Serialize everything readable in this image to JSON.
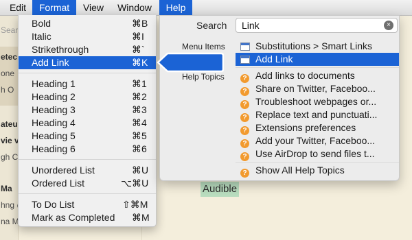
{
  "menubar": {
    "items": [
      {
        "label": "Edit",
        "active": false
      },
      {
        "label": "Format",
        "active": true
      },
      {
        "label": "View",
        "active": false
      },
      {
        "label": "Window",
        "active": false
      },
      {
        "label": "Help",
        "active": true
      }
    ]
  },
  "background": {
    "sidebar_fragments": [
      "Sear",
      "etec",
      "one",
      "h O",
      "ateu",
      "vie v",
      "gh C",
      "Ma",
      "hng @",
      "na M"
    ],
    "editor_text": "Audible"
  },
  "format_menu": {
    "groups": [
      [
        {
          "label": "Bold",
          "shortcut": "⌘B"
        },
        {
          "label": "Italic",
          "shortcut": "⌘I"
        },
        {
          "label": "Strikethrough",
          "shortcut": "⌘`"
        },
        {
          "label": "Add Link",
          "shortcut": "⌘K",
          "highlighted": true
        }
      ],
      [
        {
          "label": "Heading 1",
          "shortcut": "⌘1"
        },
        {
          "label": "Heading 2",
          "shortcut": "⌘2"
        },
        {
          "label": "Heading 3",
          "shortcut": "⌘3"
        },
        {
          "label": "Heading 4",
          "shortcut": "⌘4"
        },
        {
          "label": "Heading 5",
          "shortcut": "⌘5"
        },
        {
          "label": "Heading 6",
          "shortcut": "⌘6"
        }
      ],
      [
        {
          "label": "Unordered List",
          "shortcut": "⌘U"
        },
        {
          "label": "Ordered List",
          "shortcut": "⌥⌘U"
        }
      ],
      [
        {
          "label": "To Do List",
          "shortcut": "⇧⌘M"
        },
        {
          "label": "Mark as Completed",
          "shortcut": "⌘M"
        }
      ]
    ]
  },
  "help_menu": {
    "search_label": "Search",
    "search_value": "Link",
    "clear_icon": "×",
    "menu_items_label": "Menu Items",
    "help_topics_label": "Help Topics",
    "menu_items": [
      {
        "label": "Substitutions > Smart Links",
        "icon": "menu-item-icon"
      },
      {
        "label": "Add Link",
        "icon": "menu-item-icon",
        "highlighted": true
      }
    ],
    "help_topics": [
      {
        "label": "Add links to documents",
        "icon": "help-icon"
      },
      {
        "label": "Share on Twitter, Faceboo...",
        "icon": "help-icon"
      },
      {
        "label": "Troubleshoot webpages or...",
        "icon": "help-icon"
      },
      {
        "label": "Replace text and punctuati...",
        "icon": "help-icon"
      },
      {
        "label": "Extensions preferences",
        "icon": "help-icon"
      },
      {
        "label": "Add your Twitter, Faceboo...",
        "icon": "help-icon"
      },
      {
        "label": "Use AirDrop to send files t...",
        "icon": "help-icon"
      }
    ],
    "show_all": {
      "label": "Show All Help Topics",
      "icon": "help-icon"
    }
  },
  "colors": {
    "selection": "#1b63d5",
    "help_icon": "#f29a2e",
    "highlight_green": "#b9ddbf",
    "background": "#f4eedc"
  }
}
